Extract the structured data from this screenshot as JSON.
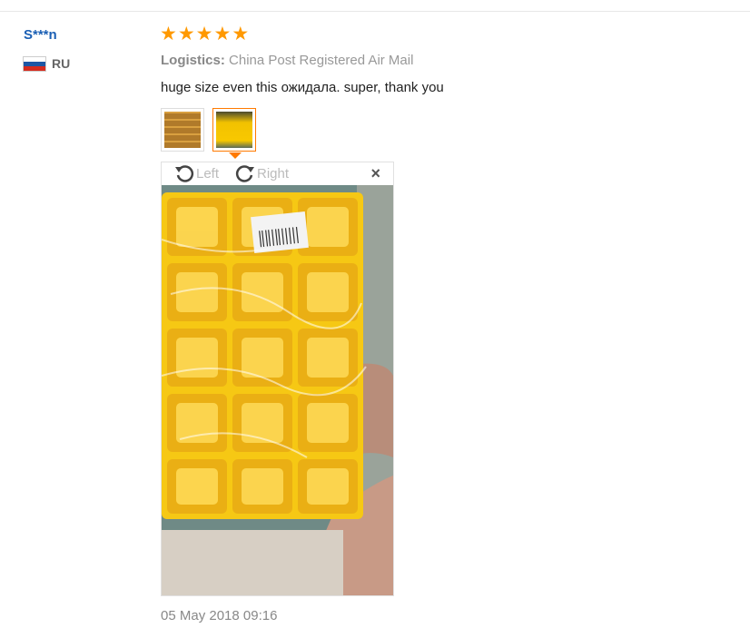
{
  "review": {
    "user_name": "S***n",
    "country_code": "RU",
    "rating": 5,
    "logistics_label": "Logistics:",
    "logistics_value": "China Post Registered Air Mail",
    "text": "huge size even this ожидала. super, thank you",
    "date": "05 May 2018 09:16"
  },
  "viewer": {
    "rotate_left_label": "Left",
    "rotate_right_label": "Right",
    "close_label": "×"
  },
  "icons": {
    "star": "star-icon",
    "rotate_left": "rotate-left-icon",
    "rotate_right": "rotate-right-icon",
    "close": "close-icon",
    "flag": "russia-flag-icon"
  },
  "colors": {
    "user_name": "#1a5fb4",
    "star": "#ff9900",
    "active_thumb": "#ff7a00"
  }
}
